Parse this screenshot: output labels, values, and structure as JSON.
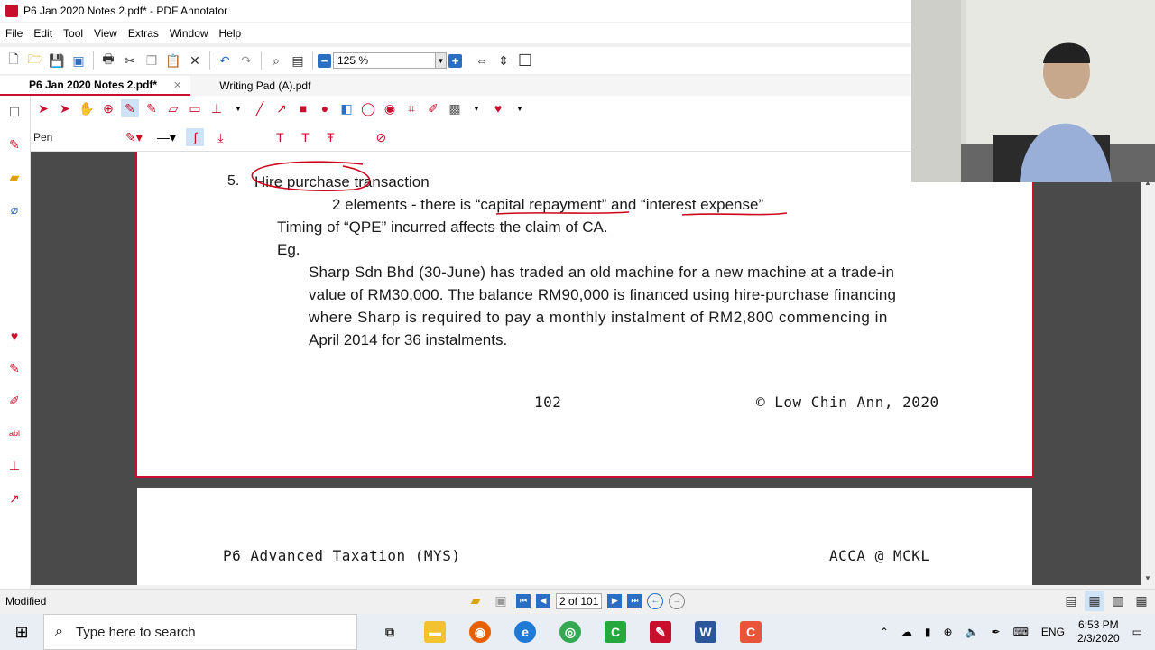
{
  "window": {
    "title": "P6 Jan 2020 Notes 2.pdf* - PDF Annotator"
  },
  "menu": [
    "File",
    "Edit",
    "Tool",
    "View",
    "Extras",
    "Window",
    "Help"
  ],
  "toolbar": {
    "zoom": "125 %"
  },
  "tabs": [
    {
      "label": "P6 Jan 2020 Notes 2.pdf*",
      "active": true
    },
    {
      "label": "Writing Pad (A).pdf",
      "active": false
    }
  ],
  "annot_toolbar": {
    "tool_label": "Pen",
    "pen_color": "#d0021b"
  },
  "document": {
    "item_number": "5.",
    "heading": "Hire purchase transaction",
    "line1": "2 elements - there is “capital repayment” and “interest expense”",
    "line2": "Timing of “QPE” incurred affects the claim of CA.",
    "line3": "Eg.",
    "para": [
      "Sharp Sdn Bhd (30-June) has traded an old machine for a new machine at a trade-in",
      "value of RM30,000. The balance RM90,000 is financed using hire-purchase financing",
      "where Sharp is required to pay a monthly instalment of RM2,800 commencing in",
      "April 2014 for 36 instalments."
    ],
    "page_number": "102",
    "copyright": "© Low Chin Ann, 2020",
    "next_header_left": "P6 Advanced Taxation (MYS)",
    "next_header_right": "ACCA @ MCKL"
  },
  "status": {
    "state": "Modified",
    "page": "2 of 101"
  },
  "taskbar": {
    "search_placeholder": "Type here to search",
    "lang": "ENG",
    "time": "6:53 PM",
    "date": "2/3/2020"
  },
  "colors": {
    "accent": "#c8102e",
    "annotation": "#d0021b"
  }
}
